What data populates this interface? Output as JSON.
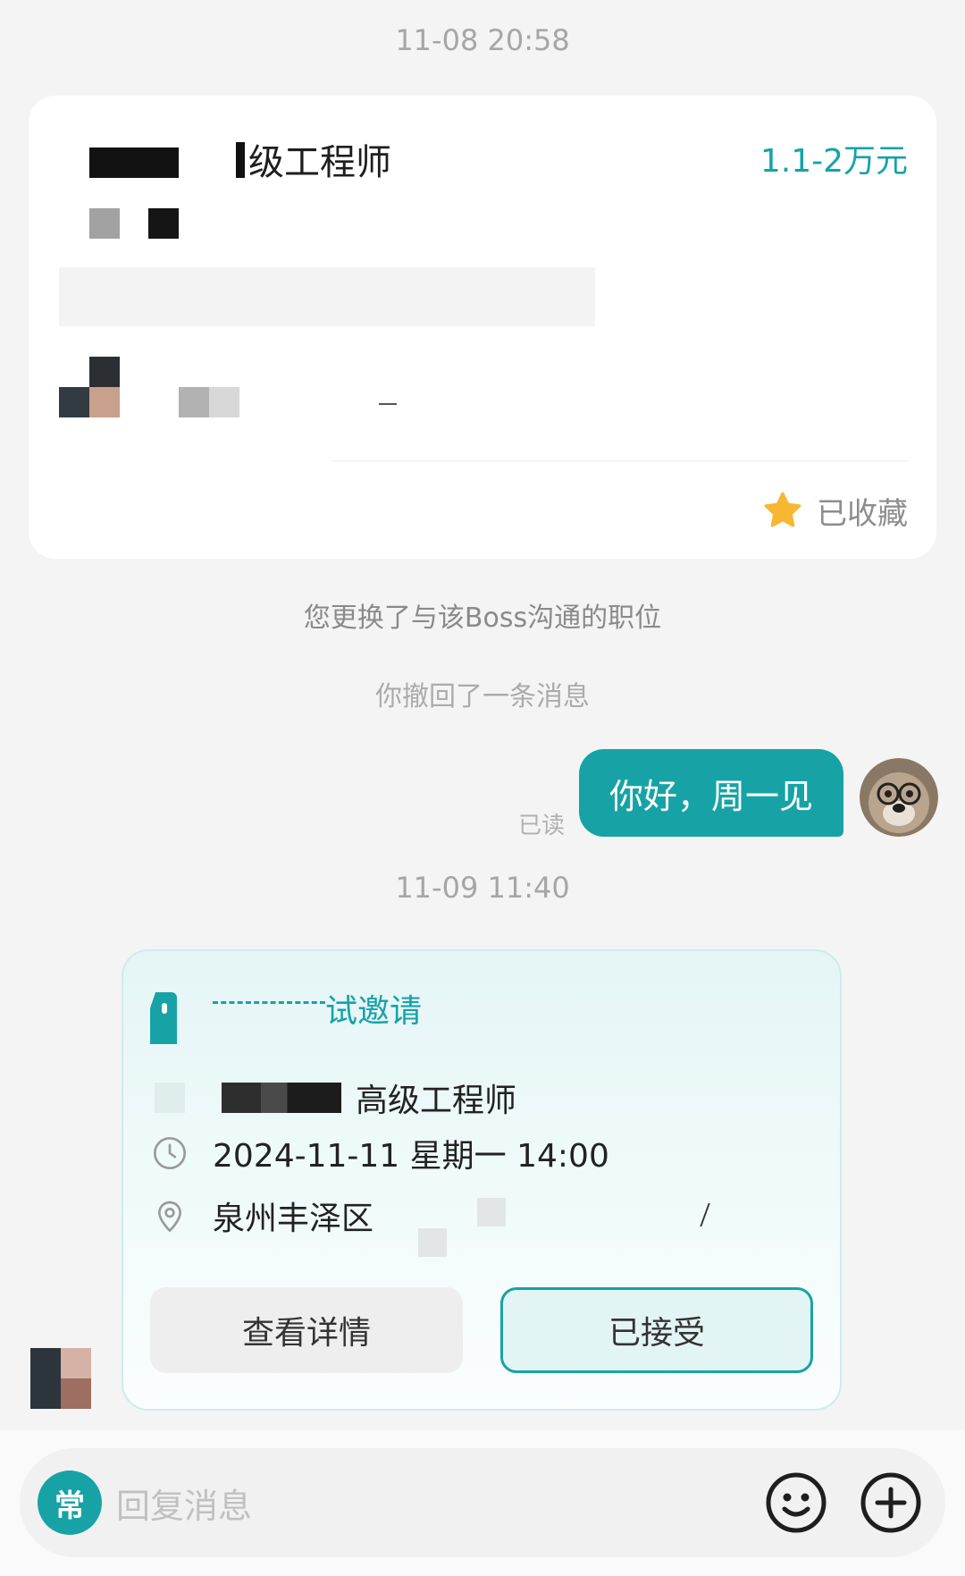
{
  "timestamps": {
    "first": "11-08 20:58",
    "second": "11-09 11:40"
  },
  "job_card": {
    "title": "级工程师",
    "salary": "1.1-2万元",
    "favorite_label": "已收藏"
  },
  "system_messages": {
    "position_changed": "您更换了与该Boss沟通的职位",
    "recalled": "你撤回了一条消息"
  },
  "my_message": {
    "text": "你好，周一见",
    "status": "已读"
  },
  "interview_invite": {
    "title": "试邀请",
    "position": "高级工程师",
    "datetime": "2024-11-11 星期一 14:00",
    "location": "泉州丰泽区",
    "detail_button": "查看详情",
    "accepted_button": "已接受"
  },
  "input_bar": {
    "quick_label": "常",
    "placeholder": "回复消息"
  },
  "colors": {
    "accent": "#17a3a6",
    "star": "#f7b731"
  },
  "icons": [
    "star-icon",
    "clock-icon",
    "location-icon",
    "emoji-icon",
    "plus-icon",
    "interview-icon"
  ]
}
